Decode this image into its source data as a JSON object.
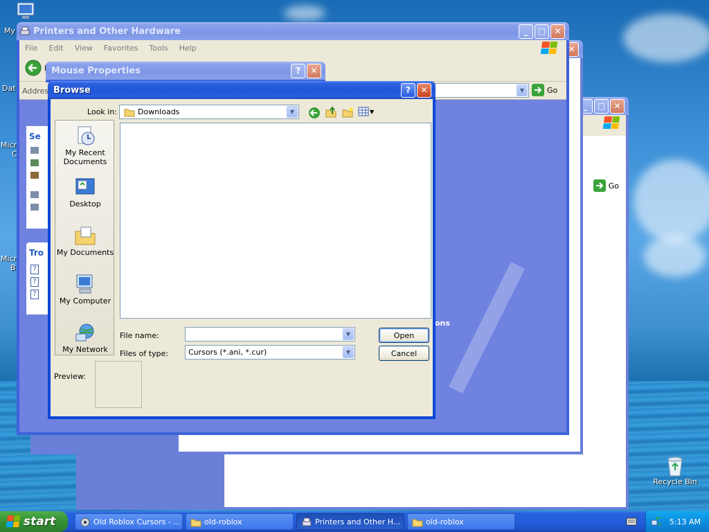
{
  "desktop": {
    "labels": {
      "my_prefix": "My",
      "dat_prefix": "Dat",
      "micro1": "Micro",
      "c1": "C",
      "micro2": "Micro",
      "b2": "B"
    },
    "recycle_bin": "Recycle Bin"
  },
  "printers_window": {
    "title": "Printers and Other Hardware",
    "menu": [
      "File",
      "Edit",
      "View",
      "Favorites",
      "Tools",
      "Help"
    ],
    "address_label": "Addres",
    "go_label": "Go",
    "side_labels": {
      "see_also": "Se",
      "troubleshoot": "Tro",
      "back_prefix": "B"
    },
    "partial_text": "ons"
  },
  "back_window": {
    "go_label": "Go"
  },
  "mouse_window": {
    "title": "Mouse Properties"
  },
  "browse_dialog": {
    "title": "Browse",
    "look_in_label": "Look in:",
    "look_in_value": "Downloads",
    "places": [
      {
        "label_line1": "My Recent",
        "label_line2": "Documents"
      },
      {
        "label_line1": "Desktop",
        "label_line2": ""
      },
      {
        "label_line1": "My Documents",
        "label_line2": ""
      },
      {
        "label_line1": "My Computer",
        "label_line2": ""
      },
      {
        "label_line1": "My Network",
        "label_line2": ""
      }
    ],
    "file_name_label": "File name:",
    "file_name_value": "",
    "files_of_type_label": "Files of type:",
    "files_of_type_value": "Cursors (*.ani, *.cur)",
    "open_button": "Open",
    "cancel_button": "Cancel",
    "preview_label": "Preview:"
  },
  "taskbar": {
    "start_label": "start",
    "tasks": [
      {
        "label": "Old Roblox Cursors - ..."
      },
      {
        "label": "old-roblox"
      },
      {
        "label": "Printers and Other H..."
      },
      {
        "label": "old-roblox"
      }
    ],
    "clock": "5:13 AM"
  },
  "colors": {
    "xp_blue": "#0a246a",
    "title_blue": "#2e62e0",
    "dialog_bg": "#ece9d8",
    "start_green": "#3c9a3a"
  }
}
